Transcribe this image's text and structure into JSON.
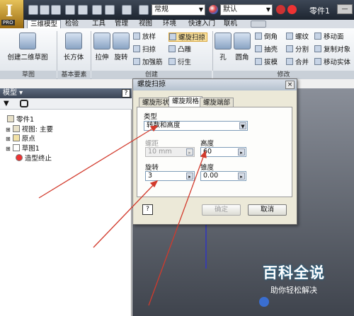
{
  "app": {
    "logo_text": "I",
    "edition": "PRO",
    "document_title": "零件1"
  },
  "quick_access": {
    "style_combo": "常规",
    "appearance_combo": "默认"
  },
  "ribbon_tabs": [
    "三维模型",
    "检验",
    "工具",
    "管理",
    "视图",
    "环境",
    "快速入门",
    "联机"
  ],
  "ribbon": {
    "sketch_group": {
      "title": "草图",
      "create_sketch": "创建二维草图"
    },
    "primitives_group": {
      "title": "基本要素",
      "box": "长方体"
    },
    "create_group": {
      "title": "创建",
      "extrude": "拉伸",
      "revolve": "旋转",
      "loft": "放样",
      "sweep": "扫掠",
      "rib": "加强筋",
      "coil": "螺旋扫掠",
      "emboss": "凸雕",
      "derive": "衍生"
    },
    "modify_group": {
      "title": "修改",
      "hole": "孔",
      "fillet": "圆角",
      "chamfer": "倒角",
      "shell": "抽壳",
      "draft": "拔模",
      "thread": "螺纹",
      "split": "分割",
      "combine": "合并",
      "move_face": "移动面",
      "copy_object": "复制对象",
      "move_body": "移动实体"
    }
  },
  "model_panel": {
    "title": "模型",
    "help": "?",
    "filter_icon": "▼",
    "search_icon": "🔭",
    "tree": [
      {
        "label": "零件1"
      },
      {
        "label": "视图: 主要"
      },
      {
        "label": "原点"
      },
      {
        "label": "草图1"
      },
      {
        "label": "造型终止"
      }
    ]
  },
  "dialog": {
    "title": "螺旋扫掠",
    "close": "×",
    "tabs": [
      "螺旋形状",
      "螺旋规格",
      "螺旋端部"
    ],
    "active_tab": 1,
    "type_label": "类型",
    "type_value": "转数和高度",
    "pitch_label": "螺距",
    "pitch_value": "10 mm",
    "height_label": "高度",
    "height_value": "60",
    "revolution_label": "旋转",
    "revolution_value": "3",
    "taper_label": "锥度",
    "taper_value": "0.00",
    "help": "?",
    "ok": "确定",
    "cancel": "取消"
  },
  "watermark": {
    "title": "百科全说",
    "subtitle": "助你轻松解决"
  },
  "colors": {
    "annotation_arrow": "#d23a2c",
    "axis": "#3a3fa8",
    "watermark_bg": "#1e8fce"
  }
}
